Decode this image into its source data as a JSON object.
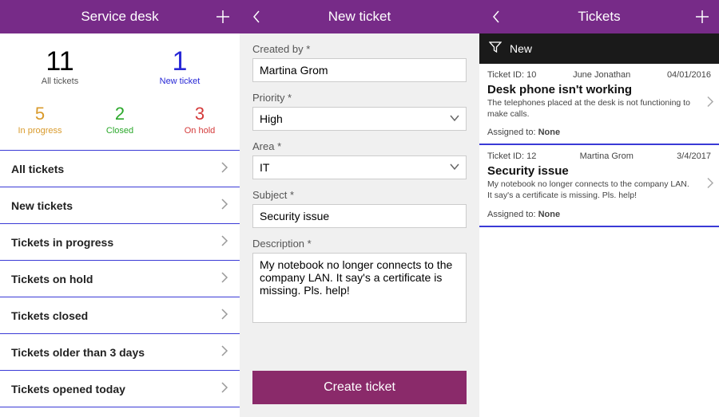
{
  "colors": {
    "brand": "#772b88",
    "accent": "#3a3ad6",
    "action": "#8a2a6a"
  },
  "panel1": {
    "title": "Service desk",
    "stats_top": [
      {
        "value": "11",
        "label": "All tickets"
      },
      {
        "value": "1",
        "label": "New ticket"
      }
    ],
    "stats_bottom": [
      {
        "value": "5",
        "label": "In progress",
        "color": "orange"
      },
      {
        "value": "2",
        "label": "Closed",
        "color": "green"
      },
      {
        "value": "3",
        "label": "On hold",
        "color": "red"
      }
    ],
    "nav": [
      "All tickets",
      "New tickets",
      "Tickets in progress",
      "Tickets on hold",
      "Tickets closed",
      "Tickets older than 3 days",
      "Tickets opened today"
    ]
  },
  "panel2": {
    "title": "New ticket",
    "fields": {
      "created_by": {
        "label": "Created by *",
        "value": "Martina Grom"
      },
      "priority": {
        "label": "Priority *",
        "value": "High"
      },
      "area": {
        "label": "Area *",
        "value": "IT"
      },
      "subject": {
        "label": "Subject *",
        "value": "Security issue"
      },
      "description": {
        "label": "Description *",
        "value": "My notebook no longer connects to the company LAN. It say's a certificate is missing. Pls. help!"
      }
    },
    "submit_label": "Create ticket"
  },
  "panel3": {
    "title": "Tickets",
    "filter_label": "New",
    "tickets": [
      {
        "id_label": "Ticket ID:",
        "id": "10",
        "requester": "June Jonathan",
        "date": "04/01/2016",
        "title": "Desk phone isn't working",
        "desc": "The telephones placed at the desk is not functioning to make calls.",
        "assigned_label": "Assigned to:",
        "assigned": "None"
      },
      {
        "id_label": "Ticket ID:",
        "id": "12",
        "requester": "Martina Grom",
        "date": "3/4/2017",
        "title": "Security issue",
        "desc": "My notebook no longer connects to the company LAN. It say's a certificate is missing. Pls. help!",
        "assigned_label": "Assigned to:",
        "assigned": "None"
      }
    ]
  }
}
